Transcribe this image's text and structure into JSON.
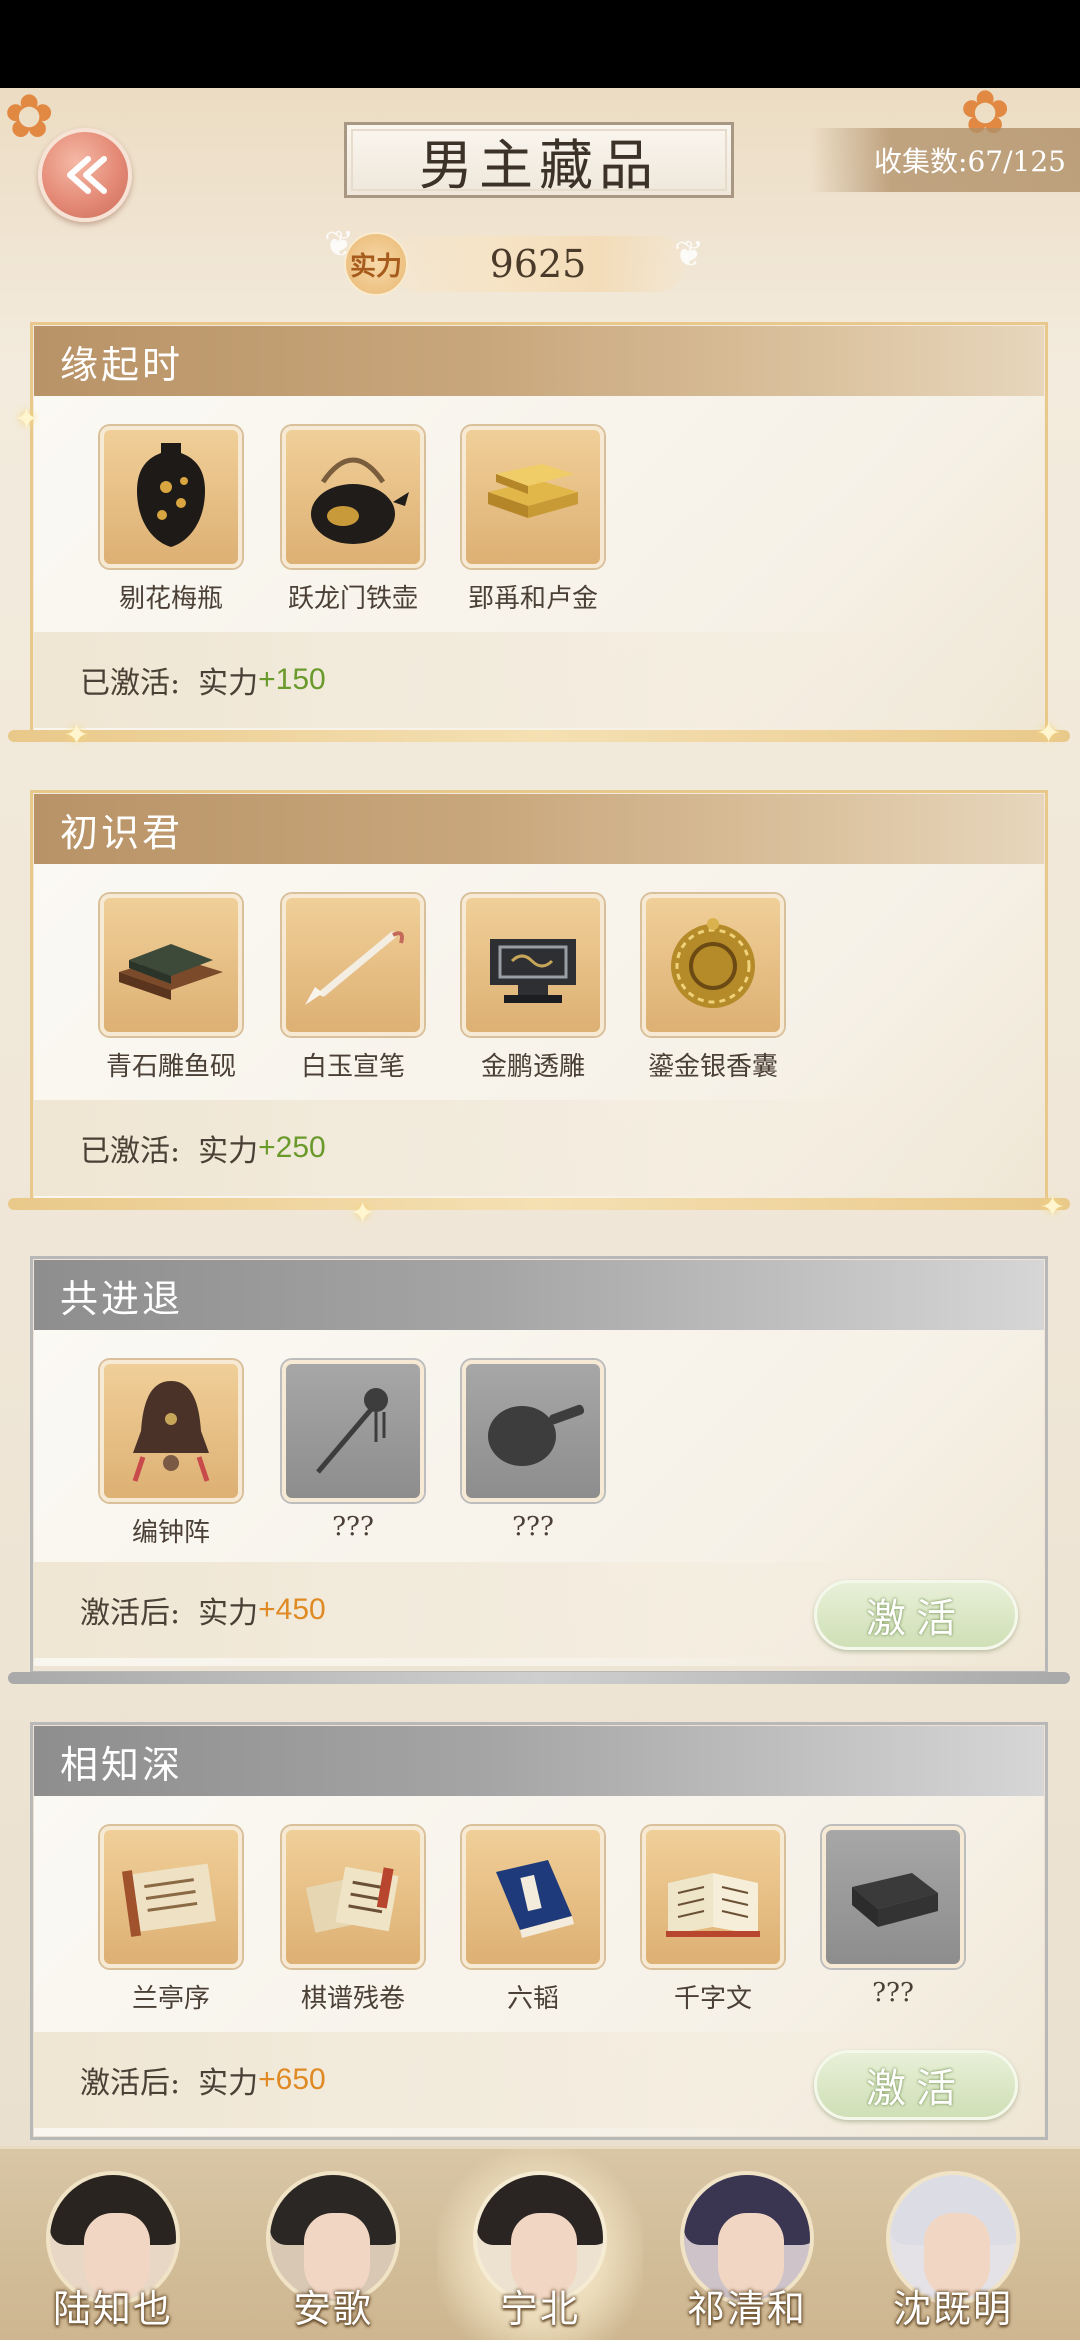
{
  "header": {
    "title": "男主藏品",
    "collection_text": "收集数:67/125",
    "power_label": "实力",
    "power_value": "9625"
  },
  "cards": [
    {
      "title": "缘起时",
      "state": "activated",
      "status_label": "已激活:",
      "power_label": "实力",
      "bonus": "+150",
      "items": [
        {
          "name": "剔花梅瓶",
          "unlocked": true,
          "icon": "vase-icon"
        },
        {
          "name": "跃龙门铁壶",
          "unlocked": true,
          "icon": "teapot-icon"
        },
        {
          "name": "郢爯和卢金",
          "unlocked": true,
          "icon": "gold-bars-icon"
        }
      ]
    },
    {
      "title": "初识君",
      "state": "activated",
      "status_label": "已激活:",
      "power_label": "实力",
      "bonus": "+250",
      "items": [
        {
          "name": "青石雕鱼砚",
          "unlocked": true,
          "icon": "inkstone-icon"
        },
        {
          "name": "白玉宣笔",
          "unlocked": true,
          "icon": "brush-icon"
        },
        {
          "name": "金鹏透雕",
          "unlocked": true,
          "icon": "carving-icon"
        },
        {
          "name": "鎏金银香囊",
          "unlocked": true,
          "icon": "censer-ball-icon"
        }
      ]
    },
    {
      "title": "共进退",
      "state": "locked",
      "status_label": "激活后:",
      "power_label": "实力",
      "bonus": "+450",
      "button": "激活",
      "items": [
        {
          "name": "编钟阵",
          "unlocked": true,
          "icon": "bell-icon"
        },
        {
          "name": "???",
          "unlocked": false,
          "icon": "hairpin-silhouette-icon"
        },
        {
          "name": "???",
          "unlocked": false,
          "icon": "fan-silhouette-icon"
        }
      ]
    },
    {
      "title": "相知深",
      "state": "locked",
      "status_label": "激活后:",
      "power_label": "实力",
      "bonus": "+650",
      "button": "激活",
      "items": [
        {
          "name": "兰亭序",
          "unlocked": true,
          "icon": "scroll-icon"
        },
        {
          "name": "棋谱残卷",
          "unlocked": true,
          "icon": "scroll-stack-icon"
        },
        {
          "name": "六韬",
          "unlocked": true,
          "icon": "book-icon"
        },
        {
          "name": "千字文",
          "unlocked": true,
          "icon": "open-book-icon"
        },
        {
          "name": "???",
          "unlocked": false,
          "icon": "box-silhouette-icon"
        }
      ]
    }
  ],
  "tabs": [
    {
      "name": "陆知也",
      "active": false
    },
    {
      "name": "安歌",
      "active": false
    },
    {
      "name": "宁北",
      "active": true
    },
    {
      "name": "祁清和",
      "active": false
    },
    {
      "name": "沈既明",
      "active": false
    }
  ],
  "colors": {
    "gold_header": "#c9a77c",
    "grey_header": "#a5a5a5",
    "bonus_green": "#6a9a2c",
    "bonus_orange": "#df8a25",
    "activate_button": "#cfdfb6"
  }
}
